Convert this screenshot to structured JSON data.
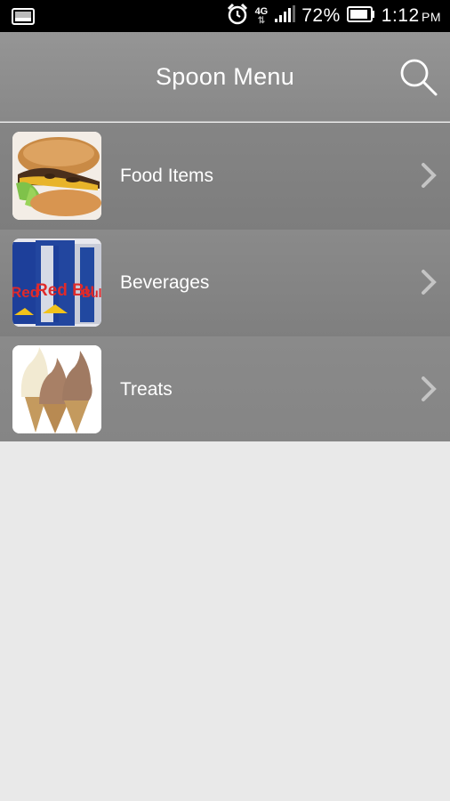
{
  "status_bar": {
    "network": "4G",
    "battery": "72%",
    "time": "1:12",
    "ampm": "PM",
    "icons": [
      "screenshot-icon",
      "alarm-icon",
      "network-4g-icon",
      "signal-icon",
      "battery-icon"
    ]
  },
  "header": {
    "title": "Spoon Menu",
    "search_icon": "search-icon"
  },
  "menu": {
    "items": [
      {
        "label": "Food Items",
        "image": "burger-image"
      },
      {
        "label": "Beverages",
        "image": "energy-drink-cans-image"
      },
      {
        "label": "Treats",
        "image": "ice-cream-cones-image"
      }
    ]
  },
  "colors": {
    "status_bar": "#000000",
    "header": "#8f8f8f",
    "list_row": "#828282",
    "background": "#e9e9e9",
    "text": "#ffffff"
  }
}
